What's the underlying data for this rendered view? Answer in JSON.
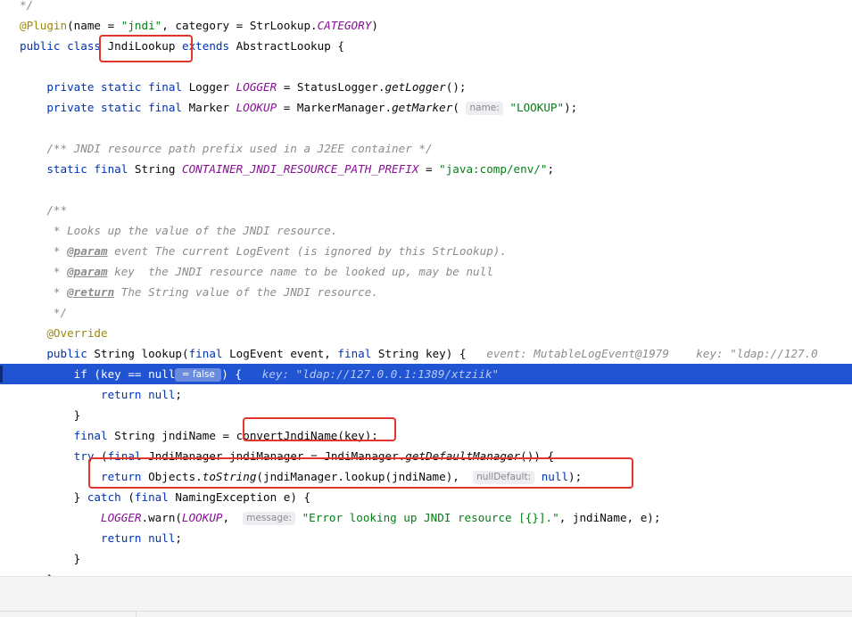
{
  "code_lines": [
    {
      "gutter": "",
      "tokens": [
        {
          "t": "*/",
          "c": "com"
        }
      ]
    },
    {
      "gutter": "",
      "tokens": [
        {
          "t": "@Plugin",
          "c": "ann"
        },
        {
          "t": "(name = "
        },
        {
          "t": "\"jndi\"",
          "c": "str"
        },
        {
          "t": ", category = StrLookup."
        },
        {
          "t": "CATEGORY",
          "c": "cst"
        },
        {
          "t": ")"
        }
      ]
    },
    {
      "gutter": "",
      "tokens": [
        {
          "t": "public class ",
          "c": "kw"
        },
        {
          "t": "JndiLookup "
        },
        {
          "t": "extends ",
          "c": "kw"
        },
        {
          "t": "AbstractLookup {"
        }
      ]
    },
    {
      "gutter": "",
      "tokens": []
    },
    {
      "gutter": "",
      "tokens": [
        {
          "t": "    "
        },
        {
          "t": "private static final ",
          "c": "kw"
        },
        {
          "t": "Logger "
        },
        {
          "t": "LOGGER",
          "c": "cst"
        },
        {
          "t": " = StatusLogger."
        },
        {
          "t": "getLogger",
          "c": "stc"
        },
        {
          "t": "();"
        }
      ]
    },
    {
      "gutter": "",
      "tokens": [
        {
          "t": "    "
        },
        {
          "t": "private static final ",
          "c": "kw"
        },
        {
          "t": "Marker "
        },
        {
          "t": "LOOKUP",
          "c": "cst"
        },
        {
          "t": " = MarkerManager."
        },
        {
          "t": "getMarker",
          "c": "stc"
        },
        {
          "t": "( "
        },
        {
          "t": "name:",
          "c": "hint"
        },
        {
          "t": " "
        },
        {
          "t": "\"LOOKUP\"",
          "c": "str"
        },
        {
          "t": ");"
        }
      ]
    },
    {
      "gutter": "",
      "tokens": []
    },
    {
      "gutter": "",
      "tokens": [
        {
          "t": "    "
        },
        {
          "t": "/** JNDI resource path prefix used in a J2EE container */",
          "c": "com"
        }
      ]
    },
    {
      "gutter": "",
      "tokens": [
        {
          "t": "    "
        },
        {
          "t": "static final ",
          "c": "kw"
        },
        {
          "t": "String "
        },
        {
          "t": "CONTAINER_JNDI_RESOURCE_PATH_PREFIX",
          "c": "cst"
        },
        {
          "t": " = "
        },
        {
          "t": "\"java:comp/env/\"",
          "c": "str"
        },
        {
          "t": ";"
        }
      ]
    },
    {
      "gutter": "",
      "tokens": []
    },
    {
      "gutter": "",
      "tokens": [
        {
          "t": "    "
        },
        {
          "t": "/**",
          "c": "com"
        }
      ]
    },
    {
      "gutter": "",
      "tokens": [
        {
          "t": "     "
        },
        {
          "t": "* Looks up the value of the JNDI resource.",
          "c": "com"
        }
      ]
    },
    {
      "gutter": "",
      "tokens": [
        {
          "t": "     "
        },
        {
          "t": "* ",
          "c": "com"
        },
        {
          "t": "@param",
          "c": "tag"
        },
        {
          "t": " event",
          "c": "com"
        },
        {
          "t": " The current LogEvent (is ignored by this StrLookup).",
          "c": "com"
        }
      ]
    },
    {
      "gutter": "",
      "tokens": [
        {
          "t": "     "
        },
        {
          "t": "* ",
          "c": "com"
        },
        {
          "t": "@param",
          "c": "tag"
        },
        {
          "t": " key",
          "c": "com"
        },
        {
          "t": "  the JNDI resource name to be looked up, may be null",
          "c": "com"
        }
      ]
    },
    {
      "gutter": "",
      "tokens": [
        {
          "t": "     "
        },
        {
          "t": "* ",
          "c": "com"
        },
        {
          "t": "@return",
          "c": "tag"
        },
        {
          "t": " The String value of the JNDI resource.",
          "c": "com"
        }
      ]
    },
    {
      "gutter": "",
      "tokens": [
        {
          "t": "     "
        },
        {
          "t": "*/",
          "c": "com"
        }
      ]
    },
    {
      "gutter": "",
      "tokens": [
        {
          "t": "    "
        },
        {
          "t": "@Override",
          "c": "ann"
        }
      ]
    },
    {
      "gutter": "",
      "tokens": [
        {
          "t": "    "
        },
        {
          "t": "public ",
          "c": "kw"
        },
        {
          "t": "String lookup("
        },
        {
          "t": "final ",
          "c": "kw"
        },
        {
          "t": "LogEvent event, "
        },
        {
          "t": "final ",
          "c": "kw"
        },
        {
          "t": "String key) {   "
        },
        {
          "t": "event: MutableLogEvent@1979    key: \"ldap://127.0",
          "c": "dbg"
        }
      ]
    },
    {
      "gutter": "",
      "exec": true,
      "tokens": [
        {
          "t": "        "
        },
        {
          "t": "if ",
          "c": "kw"
        },
        {
          "t": "(key == "
        },
        {
          "t": "null",
          "c": "kw"
        },
        {
          "t": " = false ",
          "c": "hint blue"
        },
        {
          "t": ") {   "
        },
        {
          "t": "key: \"ldap://127.0.0.1:1389/xtziik\"",
          "c": "dbg"
        }
      ]
    },
    {
      "gutter": "",
      "tokens": [
        {
          "t": "            "
        },
        {
          "t": "return null",
          "c": "kw"
        },
        {
          "t": ";"
        }
      ]
    },
    {
      "gutter": "",
      "tokens": [
        {
          "t": "        }"
        }
      ]
    },
    {
      "gutter": "",
      "tokens": [
        {
          "t": "        "
        },
        {
          "t": "final ",
          "c": "kw"
        },
        {
          "t": "String jndiName = convertJndiName(key);"
        }
      ]
    },
    {
      "gutter": "",
      "tokens": [
        {
          "t": "        "
        },
        {
          "t": "try ",
          "c": "kw"
        },
        {
          "t": "("
        },
        {
          "t": "final ",
          "c": "kw"
        },
        {
          "t": "JndiManager jndiManager = JndiManager."
        },
        {
          "t": "getDefaultManager",
          "c": "stc"
        },
        {
          "t": "()) {"
        }
      ]
    },
    {
      "gutter": "",
      "tokens": [
        {
          "t": "            "
        },
        {
          "t": "return ",
          "c": "kw"
        },
        {
          "t": "Objects."
        },
        {
          "t": "toString",
          "c": "stc"
        },
        {
          "t": "(jndiManager.lookup(jndiName),  "
        },
        {
          "t": "nullDefault:",
          "c": "hint"
        },
        {
          "t": " "
        },
        {
          "t": "null",
          "c": "kw"
        },
        {
          "t": ");"
        }
      ]
    },
    {
      "gutter": "",
      "tokens": [
        {
          "t": "        } "
        },
        {
          "t": "catch ",
          "c": "kw"
        },
        {
          "t": "("
        },
        {
          "t": "final ",
          "c": "kw"
        },
        {
          "t": "NamingException e) {"
        }
      ]
    },
    {
      "gutter": "",
      "tokens": [
        {
          "t": "            "
        },
        {
          "t": "LOGGER",
          "c": "cst"
        },
        {
          "t": ".warn("
        },
        {
          "t": "LOOKUP",
          "c": "cst"
        },
        {
          "t": ",  "
        },
        {
          "t": "message:",
          "c": "hint"
        },
        {
          "t": " "
        },
        {
          "t": "\"Error looking up JNDI resource [{}].\"",
          "c": "str"
        },
        {
          "t": ", jndiName, e);"
        }
      ]
    },
    {
      "gutter": "",
      "tokens": [
        {
          "t": "            "
        },
        {
          "t": "return null",
          "c": "kw"
        },
        {
          "t": ";"
        }
      ]
    },
    {
      "gutter": "",
      "tokens": [
        {
          "t": "        }"
        }
      ]
    },
    {
      "gutter": "",
      "tokens": [
        {
          "t": "    }"
        }
      ]
    }
  ],
  "colors": {
    "keyword": "#0033b3",
    "annotation": "#9e880d",
    "string": "#067d17",
    "constant": "#871094",
    "comment": "#8c8c8c",
    "execution_line": "#2154d3",
    "highlight_box": "#e0362c"
  },
  "icons": {
    "execution_point": "breakpoint-arrow-icon"
  }
}
